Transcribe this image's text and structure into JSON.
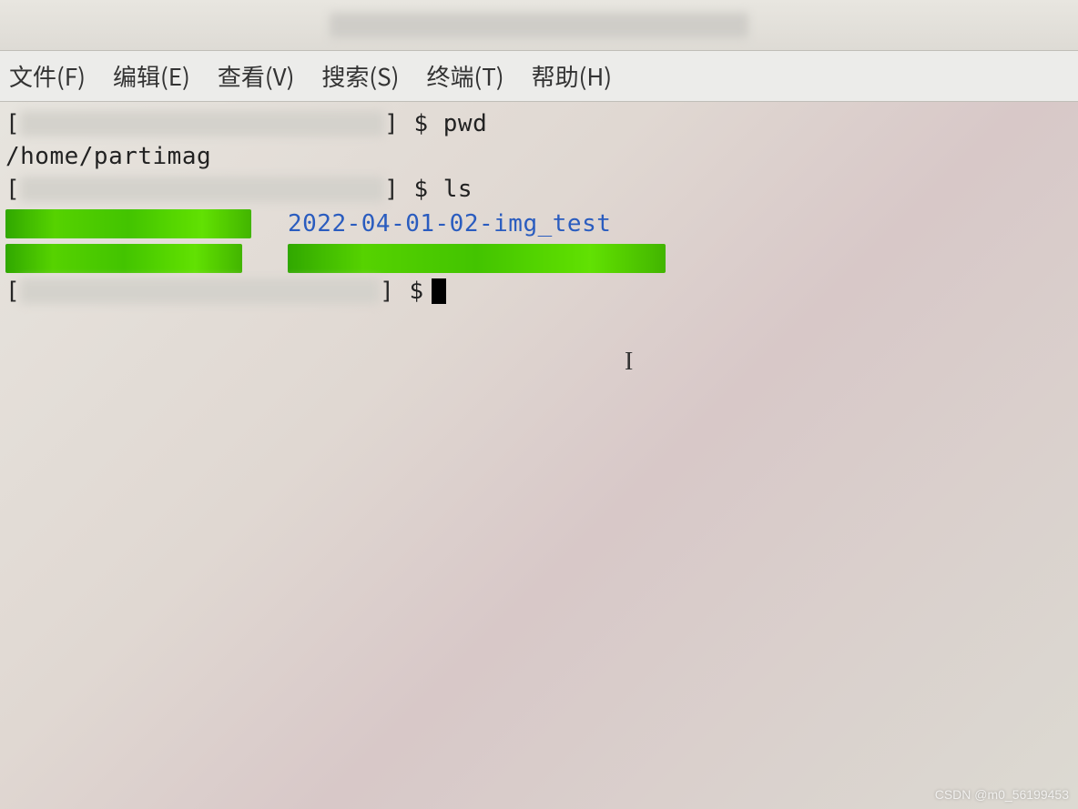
{
  "menubar": {
    "file": "文件(F)",
    "edit": "编辑(E)",
    "view": "查看(V)",
    "search": "搜索(S)",
    "terminal": "终端(T)",
    "help": "帮助(H)"
  },
  "terminal": {
    "prompt_open": "[",
    "prompt_close": "] $",
    "cmd_pwd": "pwd",
    "pwd_output": "/home/partimag",
    "cmd_ls": "ls",
    "ls_dir_entry": "2022-04-01-02-img_test",
    "final_prompt": "] $"
  },
  "watermark": "CSDN @m0_56199453"
}
